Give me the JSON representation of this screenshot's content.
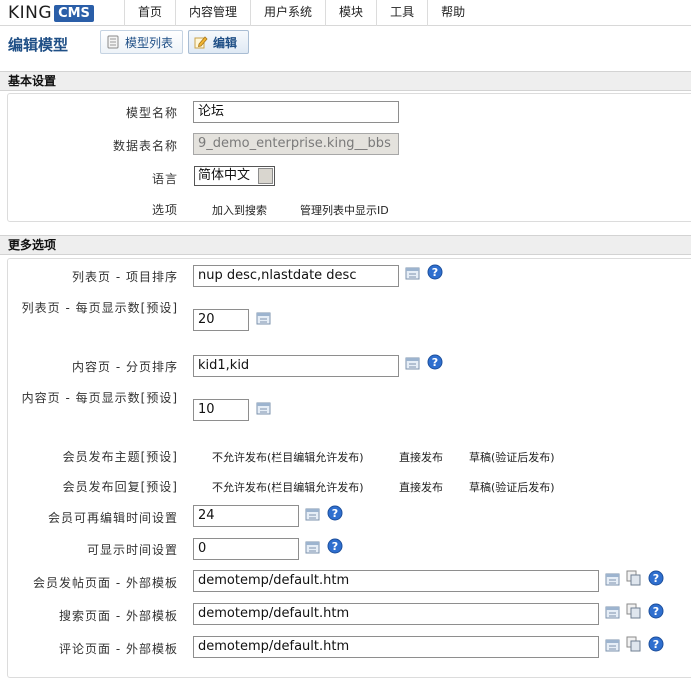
{
  "logo": {
    "king": "KING",
    "cms": "CMS"
  },
  "nav": [
    "首页",
    "内容管理",
    "用户系统",
    "模块",
    "工具",
    "帮助"
  ],
  "header": {
    "title": "编辑模型",
    "btn_list": "模型列表",
    "btn_edit": "编辑"
  },
  "basic": {
    "title": "基本设置",
    "model_name_label": "模型名称",
    "model_name_value": "论坛",
    "table_label": "数据表名称",
    "table_value": "9_demo_enterprise.king__bbs",
    "lang_label": "语言",
    "lang_value": "简体中文",
    "options_label": "选项",
    "opt_search": "加入到搜索",
    "opt_showid": "管理列表中显示ID"
  },
  "more": {
    "title": "更多选项",
    "list_sort_label": "列表页 - 项目排序",
    "list_sort_value": "nup desc,nlastdate desc",
    "list_perpage_label": "列表页 - 每页显示数[预设]",
    "list_perpage_value": "20",
    "content_sort_label": "内容页 - 分页排序",
    "content_sort_value": "kid1,kid",
    "content_perpage_label": "内容页 - 每页显示数[预设]",
    "content_perpage_value": "10",
    "topic_label": "会员发布主题[预设]",
    "reply_label": "会员发布回复[预设]",
    "opt_disallow": "不允许发布(栏目编辑允许发布)",
    "opt_direct": "直接发布",
    "opt_draft": "草稿(验证后发布)",
    "edit_time_label": "会员可再编辑时间设置",
    "edit_time_value": "24",
    "show_time_label": "可显示时间设置",
    "show_time_value": "0",
    "post_tpl_label": "会员发帖页面 - 外部模板",
    "post_tpl_value": "demotemp/default.htm",
    "search_tpl_label": "搜索页面 - 外部模板",
    "search_tpl_value": "demotemp/default.htm",
    "comment_tpl_label": "评论页面 - 外部模板",
    "comment_tpl_value": "demotemp/default.htm"
  },
  "icons": {
    "template": "template-list-icon",
    "copy": "copy-icon",
    "help": "help-icon"
  },
  "colors": {
    "brand": "#2a5ea8",
    "title": "#1f4f86",
    "help": "#2f6fcf"
  }
}
